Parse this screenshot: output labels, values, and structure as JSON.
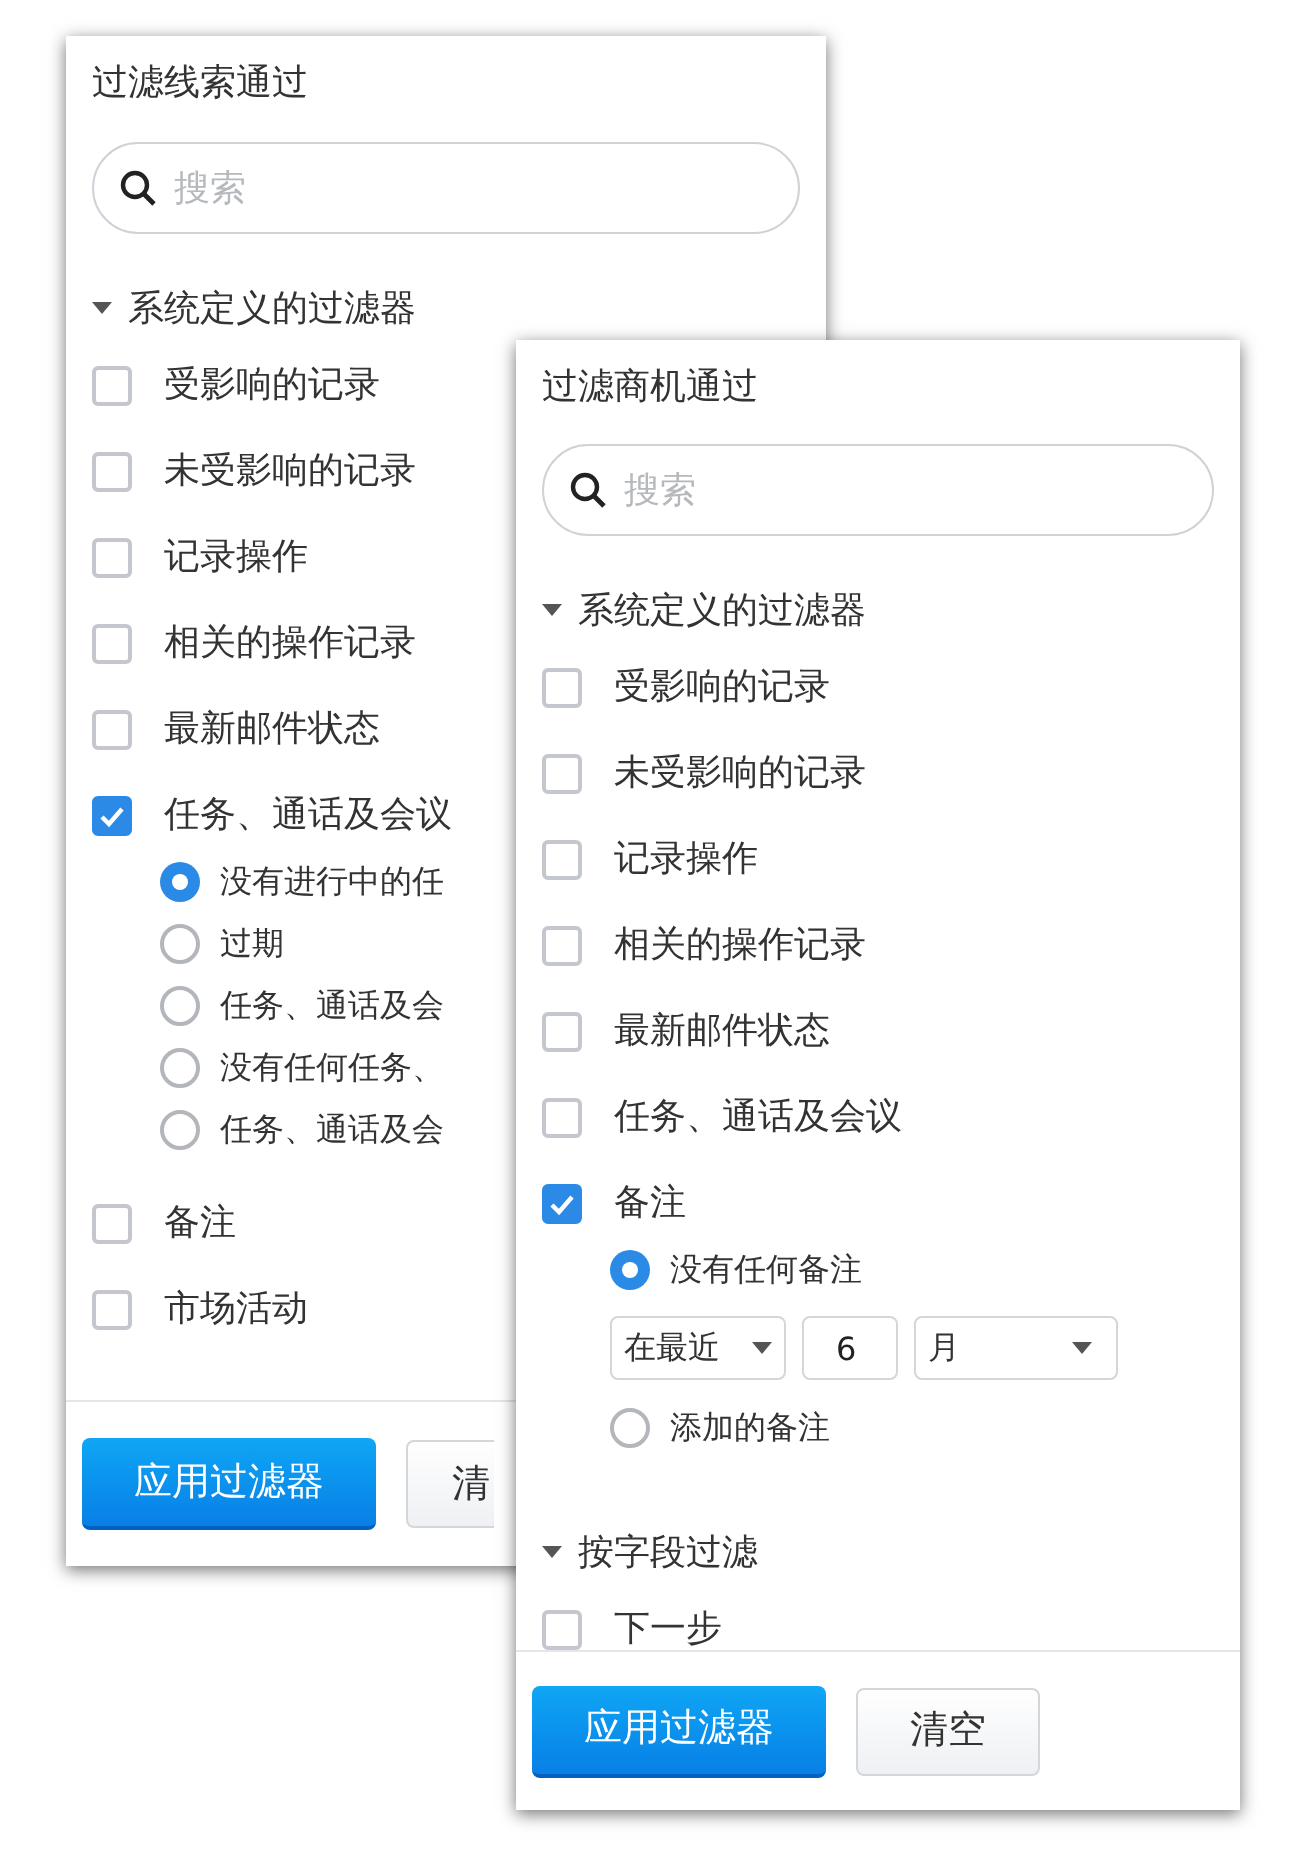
{
  "panels": [
    {
      "title": "过滤线索通过",
      "search": {
        "placeholder": "搜索"
      },
      "sections": [
        {
          "title": "系统定义的过滤器",
          "expanded": true,
          "items": [
            {
              "kind": "checkbox",
              "label": "受影响的记录",
              "checked": false
            },
            {
              "kind": "checkbox",
              "label": "未受影响的记录",
              "checked": false
            },
            {
              "kind": "checkbox",
              "label": "记录操作",
              "checked": false
            },
            {
              "kind": "checkbox",
              "label": "相关的操作记录",
              "checked": false
            },
            {
              "kind": "checkbox",
              "label": "最新邮件状态",
              "checked": false
            },
            {
              "kind": "checkbox",
              "label": "任务、通话及会议",
              "checked": true,
              "children": [
                {
                  "kind": "radio",
                  "label": "没有进行中的任",
                  "selected": true
                },
                {
                  "kind": "radio",
                  "label": "过期",
                  "selected": false
                },
                {
                  "kind": "radio",
                  "label": "任务、通话及会",
                  "selected": false
                },
                {
                  "kind": "radio",
                  "label": "没有任何任务、",
                  "selected": false
                },
                {
                  "kind": "radio",
                  "label": "任务、通话及会",
                  "selected": false
                }
              ]
            },
            {
              "kind": "checkbox",
              "label": "备注",
              "checked": false
            },
            {
              "kind": "checkbox",
              "label": "市场活动",
              "checked": false
            }
          ]
        }
      ],
      "buttons": [
        {
          "label": "应用过滤器",
          "kind": "primary"
        },
        {
          "label": "清",
          "kind": "secondary"
        }
      ]
    },
    {
      "title": "过滤商机通过",
      "search": {
        "placeholder": "搜索"
      },
      "sections": [
        {
          "title": "系统定义的过滤器",
          "expanded": true,
          "items": [
            {
              "kind": "checkbox",
              "label": "受影响的记录",
              "checked": false
            },
            {
              "kind": "checkbox",
              "label": "未受影响的记录",
              "checked": false
            },
            {
              "kind": "checkbox",
              "label": "记录操作",
              "checked": false
            },
            {
              "kind": "checkbox",
              "label": "相关的操作记录",
              "checked": false
            },
            {
              "kind": "checkbox",
              "label": "最新邮件状态",
              "checked": false
            },
            {
              "kind": "checkbox",
              "label": "任务、通话及会议",
              "checked": false
            },
            {
              "kind": "checkbox",
              "label": "备注",
              "checked": true,
              "children": [
                {
                  "kind": "radio",
                  "label": "没有任何备注",
                  "selected": true
                },
                {
                  "kind": "range",
                  "mode": "在最近",
                  "value": "6",
                  "unit": "月"
                },
                {
                  "kind": "radio",
                  "label": "添加的备注",
                  "selected": false
                }
              ]
            }
          ]
        },
        {
          "title": "按字段过滤",
          "expanded": true,
          "items": [
            {
              "kind": "checkbox",
              "label": "下一步",
              "checked": false
            }
          ]
        }
      ],
      "buttons": [
        {
          "label": "应用过滤器",
          "kind": "primary"
        },
        {
          "label": "清空",
          "kind": "secondary"
        }
      ]
    }
  ]
}
